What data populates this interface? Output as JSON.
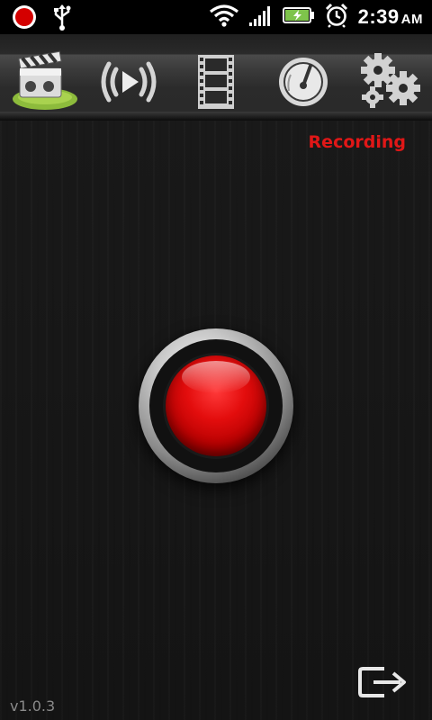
{
  "status_bar": {
    "time": "2:39",
    "ampm": "AM",
    "icons": [
      "record-indicator-icon",
      "usb-icon",
      "wifi-icon",
      "signal-icon",
      "battery-charging-icon",
      "alarm-icon"
    ]
  },
  "tabs": [
    {
      "name": "clapperboard-icon",
      "active": true
    },
    {
      "name": "broadcast-play-icon",
      "active": false
    },
    {
      "name": "film-strip-icon",
      "active": false
    },
    {
      "name": "speedometer-icon",
      "active": false
    },
    {
      "name": "settings-gears-icon",
      "active": false
    }
  ],
  "main": {
    "status_text": "Recording",
    "record_button": "record-button",
    "exit_icon": "exit-icon",
    "version": "v1.0.3"
  },
  "colors": {
    "recording_red": "#e01717",
    "active_tab_green": "#7cb342",
    "version_gray": "#8a8a8a"
  }
}
